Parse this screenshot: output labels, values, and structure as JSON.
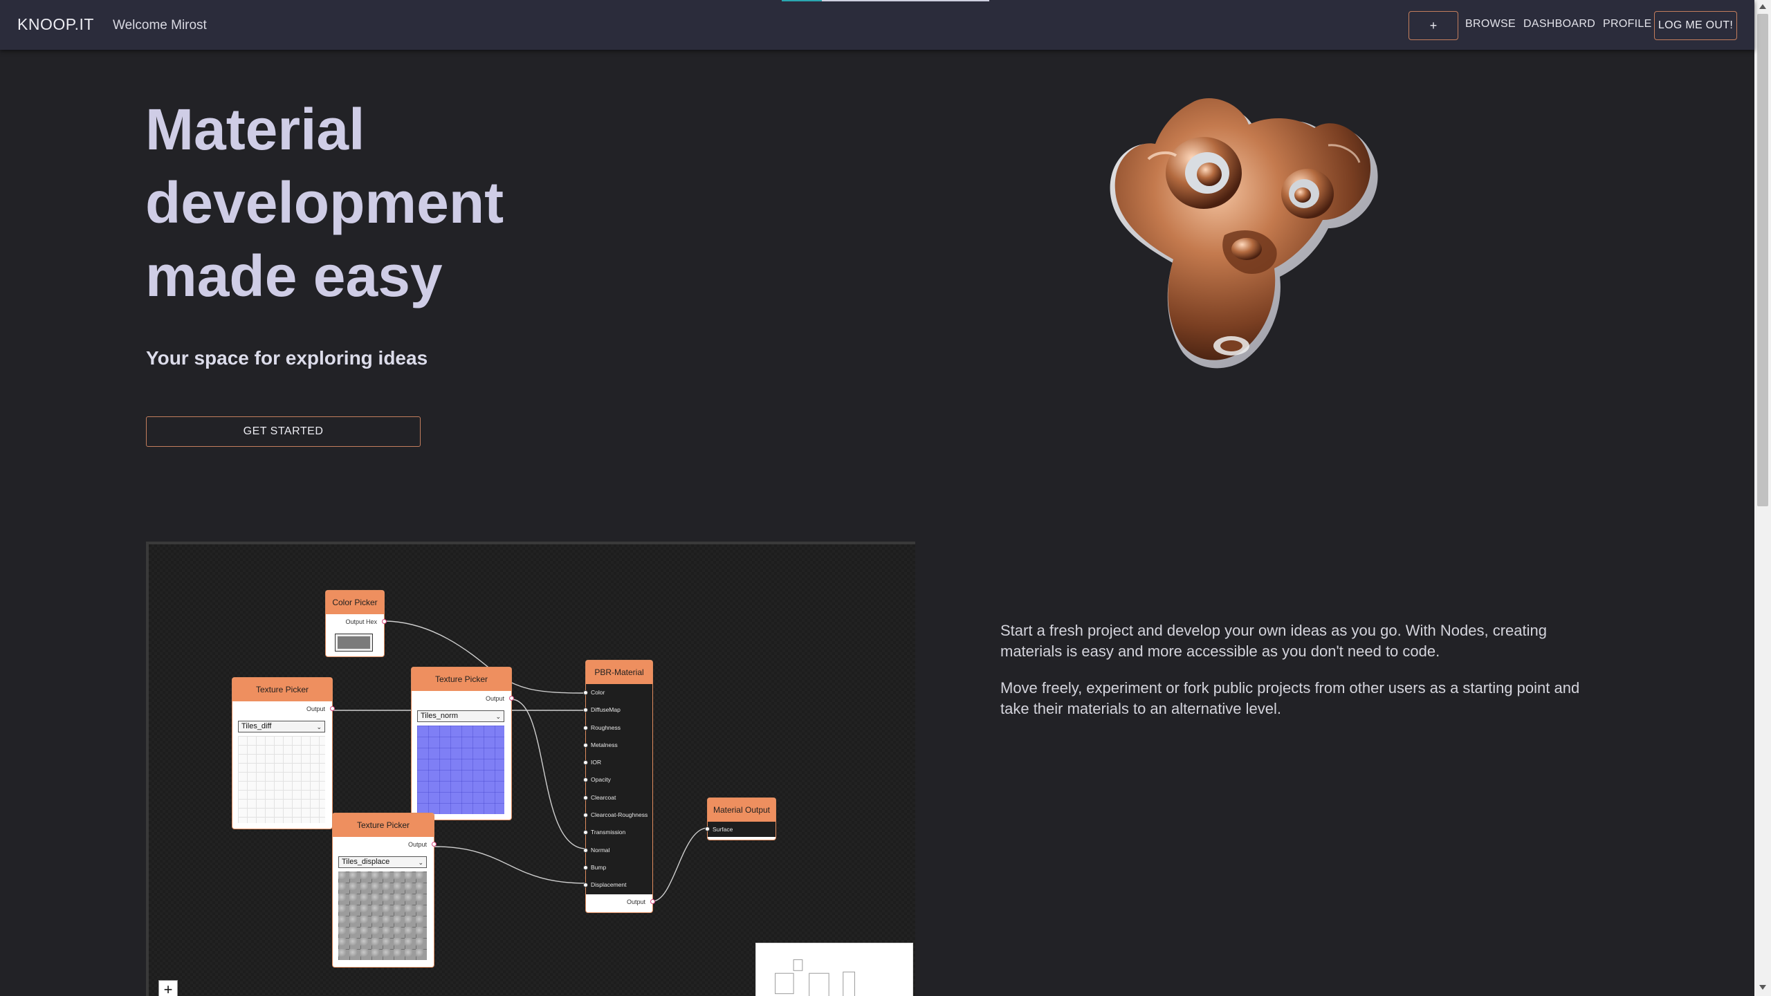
{
  "nav": {
    "brand": "KNOOP.IT",
    "welcome": "Welcome Mirost",
    "add_label": "+",
    "links": [
      "BROWSE",
      "DASHBOARD",
      "PROFILE"
    ],
    "logout_label": "LOG ME OUT!"
  },
  "hero": {
    "title_lines": [
      "Material",
      "development",
      "made easy"
    ],
    "subtitle": "Your space for exploring ideas",
    "cta_label": "GET STARTED"
  },
  "editor": {
    "color_picker": {
      "title": "Color Picker",
      "output": "Output Hex",
      "swatch_color": "#7b7b7b"
    },
    "texture_pickers": [
      {
        "title": "Texture Picker",
        "output": "Output",
        "selected": "Tiles_diff"
      },
      {
        "title": "Texture Picker",
        "output": "Output",
        "selected": "Tiles_norm"
      },
      {
        "title": "Texture Picker",
        "output": "Output",
        "selected": "Tiles_displace"
      }
    ],
    "pbr": {
      "title": "PBR-Material",
      "inputs": [
        "Color",
        "DiffuseMap",
        "Roughness",
        "Metalness",
        "IOR",
        "Opacity",
        "Clearcoat",
        "Clearcoat-Roughness",
        "Transmission",
        "Normal",
        "Bump",
        "Displacement"
      ],
      "output": "Output"
    },
    "material_output": {
      "title": "Material Output",
      "input": "Surface"
    },
    "zoom_in_label": "+"
  },
  "description": {
    "p1": "Start a fresh project and develop your own ideas as you go. With Nodes, creating materials is easy and more accessible as you don't need to code.",
    "p2": "Move freely, experiment or fork public projects from other users as a starting point and take their materials to an alternative level."
  },
  "colors": {
    "accent": "#ee8f5f",
    "nav_bg": "#2b2c3b",
    "page_bg": "#222226",
    "hero_text": "#cfcde6"
  }
}
